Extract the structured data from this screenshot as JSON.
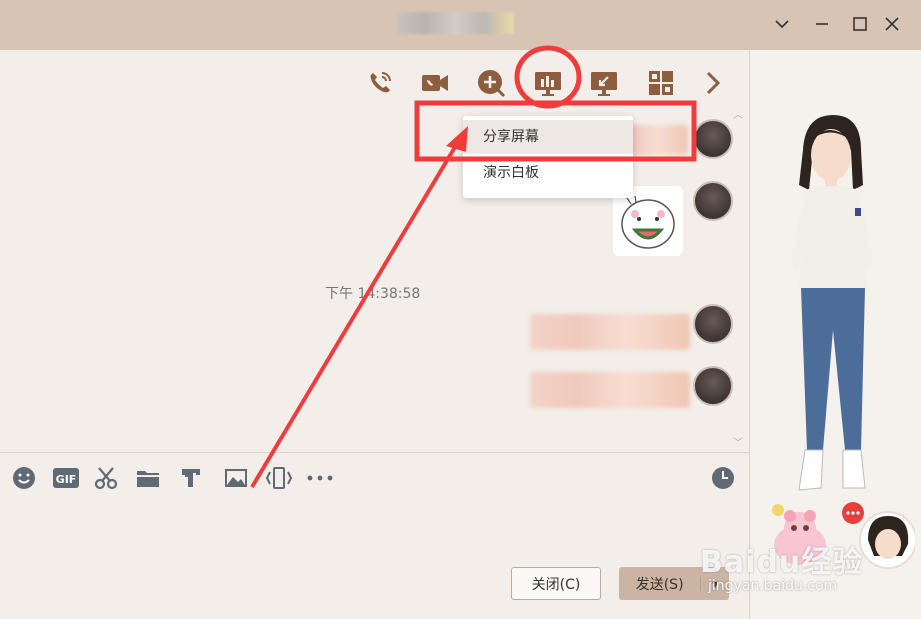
{
  "window": {
    "title_blurred": true,
    "controls": [
      "chevron-down-icon",
      "minimize-icon",
      "maximize-icon",
      "close-icon"
    ]
  },
  "toolbar": {
    "icons": [
      "phone-call-icon",
      "video-call-icon",
      "add-contact-icon",
      "screen-share-icon",
      "remote-desktop-icon",
      "apps-grid-icon",
      "chevron-right-icon"
    ]
  },
  "share_menu": {
    "items": [
      {
        "label": "分享屏幕",
        "highlighted": true
      },
      {
        "label": "演示白板",
        "highlighted": false
      }
    ]
  },
  "chat": {
    "timestamp": "下午 14:38:58"
  },
  "input_toolbar": {
    "icons": [
      "emoji-icon",
      "gif-icon",
      "scissors-icon",
      "folder-icon",
      "font-icon",
      "image-icon",
      "screen-shake-icon",
      "more-icon",
      "history-clock-icon"
    ],
    "gif_label": "GIF"
  },
  "buttons": {
    "close_label": "关闭(C)",
    "send_label": "发送(S)"
  },
  "watermark": {
    "main": "Baidu经验",
    "sub": "jingyan.baidu.com"
  },
  "colors": {
    "titlebar": "#d8c4b5",
    "accent_icon": "#8c5e3f",
    "annotation_red": "#f03c3c",
    "send_button": "#cbb4a3"
  }
}
